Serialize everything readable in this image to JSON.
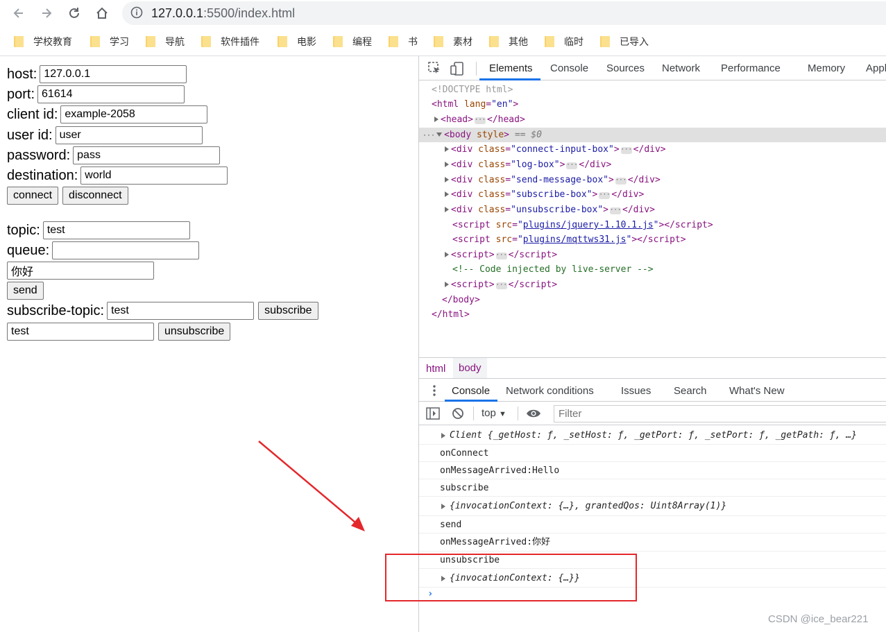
{
  "browser": {
    "url_host": "127.0.0.1",
    "url_rest": ":5500/index.html",
    "bookmarks": [
      "学校教育",
      "学习",
      "导航",
      "软件插件",
      "电影",
      "编程",
      "书",
      "素材",
      "其他",
      "临时",
      "已导入"
    ]
  },
  "form": {
    "host_label": "host:",
    "host_value": "127.0.0.1",
    "port_label": "port:",
    "port_value": "61614",
    "clientid_label": "client id:",
    "clientid_value": "example-2058",
    "userid_label": "user id:",
    "userid_value": "user",
    "password_label": "password:",
    "password_value": "pass",
    "destination_label": "destination:",
    "destination_value": "world",
    "connect_label": "connect",
    "disconnect_label": "disconnect",
    "topic_label": "topic:",
    "topic_value": "test",
    "queue_label": "queue:",
    "queue_value": "",
    "message_value": "你好",
    "send_label": "send",
    "subscribe_topic_label": "subscribe-topic:",
    "subscribe_topic_value": "test",
    "subscribe_label": "subscribe",
    "unsubscribe_value": "test",
    "unsubscribe_label": "unsubscribe"
  },
  "devtools": {
    "tabs": [
      "Elements",
      "Console",
      "Sources",
      "Network",
      "Performance",
      "Memory",
      "Applic"
    ],
    "dom": {
      "doctype": "<!DOCTYPE html>",
      "html_open": "html",
      "lang_attr": "lang",
      "lang_val": "\"en\"",
      "head": "head",
      "body": "body",
      "style_attr": "style",
      "dollar": "== $0",
      "div": "div",
      "class_attr": "class",
      "div_classes": [
        "\"connect-input-box\"",
        "\"log-box\"",
        "\"send-message-box\"",
        "\"subscribe-box\"",
        "\"unsubscribe-box\""
      ],
      "script": "script",
      "src_attr": "src",
      "script_srcs": [
        "plugins/jquery-1.10.1.js",
        "plugins/mqttws31.js"
      ],
      "comment": "<!-- Code injected by live-server -->"
    },
    "breadcrumbs": [
      "html",
      "body"
    ],
    "drawer_tabs": [
      "Console",
      "Network conditions",
      "Issues",
      "Search",
      "What's New"
    ],
    "context": "top",
    "filter_placeholder": "Filter",
    "log": [
      "Client {_getHost: ƒ, _setHost: ƒ, _getPort: ƒ, _setPort: ƒ, _getPath: ƒ, …}",
      "onConnect",
      "onMessageArrived:Hello",
      "subscribe",
      "{invocationContext: {…}, grantedQos: Uint8Array(1)}",
      "send",
      "onMessageArrived:你好",
      "unsubscribe",
      "{invocationContext: {…}}"
    ]
  },
  "watermark": "CSDN @ice_bear221"
}
